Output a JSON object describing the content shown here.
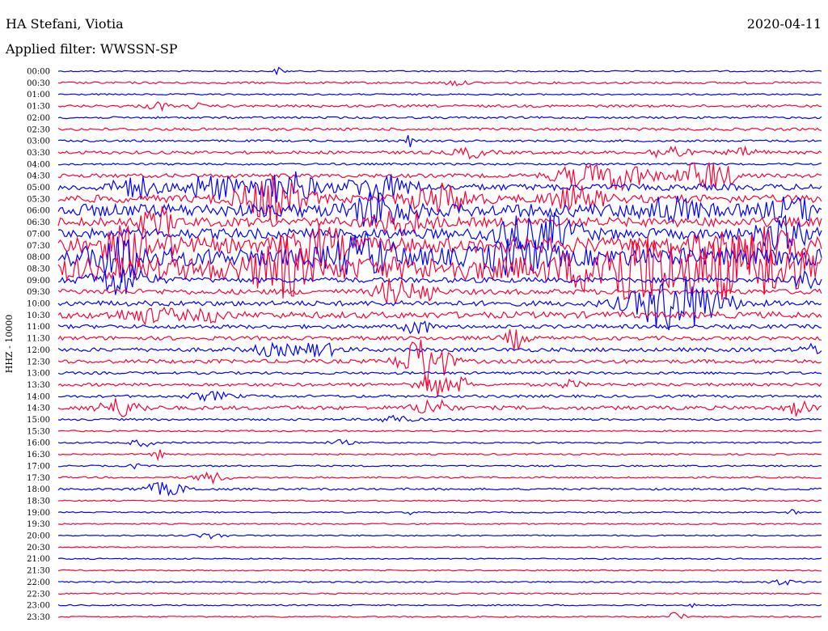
{
  "header": {
    "station": "HA Stefani, Viotia",
    "date": "2020-04-11",
    "filter_label": "Applied filter: WWSSN-SP"
  },
  "chart_data": {
    "type": "line",
    "title": "HA Stefani, Viotia",
    "ylabel": "HHZ - 10000",
    "x_unit": "minutes",
    "xlim": [
      0,
      30
    ],
    "colors": {
      "blue": "#0000ff",
      "red": "#ff0033"
    },
    "series": [
      {
        "label": "00:00",
        "color": "blue",
        "level": 0.05,
        "events": [
          {
            "at": 0.29,
            "amp": 0.3,
            "dur": 0.01
          }
        ]
      },
      {
        "label": "00:30",
        "color": "red",
        "level": 0.08,
        "events": [
          {
            "at": 0.52,
            "amp": 0.2,
            "dur": 0.02
          }
        ]
      },
      {
        "label": "01:00",
        "color": "blue",
        "level": 0.06,
        "events": []
      },
      {
        "label": "01:30",
        "color": "red",
        "level": 0.1,
        "events": [
          {
            "at": 0.13,
            "amp": 0.3,
            "dur": 0.02
          },
          {
            "at": 0.18,
            "amp": 0.25,
            "dur": 0.01
          }
        ]
      },
      {
        "label": "02:00",
        "color": "blue",
        "level": 0.08,
        "events": []
      },
      {
        "label": "02:30",
        "color": "red",
        "level": 0.1,
        "events": []
      },
      {
        "label": "03:00",
        "color": "blue",
        "level": 0.08,
        "events": [
          {
            "at": 0.46,
            "amp": 0.5,
            "dur": 0.005
          }
        ]
      },
      {
        "label": "03:30",
        "color": "red",
        "level": 0.12,
        "events": [
          {
            "at": 0.54,
            "amp": 0.4,
            "dur": 0.03
          },
          {
            "at": 0.8,
            "amp": 0.6,
            "dur": 0.03
          },
          {
            "at": 0.9,
            "amp": 0.3,
            "dur": 0.03
          }
        ]
      },
      {
        "label": "04:00",
        "color": "blue",
        "level": 0.08,
        "events": []
      },
      {
        "label": "04:30",
        "color": "red",
        "level": 0.15,
        "events": [
          {
            "at": 0.68,
            "amp": 0.7,
            "dur": 0.05
          },
          {
            "at": 0.74,
            "amp": 1.0,
            "dur": 0.05
          },
          {
            "at": 0.85,
            "amp": 1.2,
            "dur": 0.05
          }
        ]
      },
      {
        "label": "05:00",
        "color": "blue",
        "level": 0.25,
        "events": [
          {
            "at": 0.1,
            "amp": 0.8,
            "dur": 0.04
          },
          {
            "at": 0.2,
            "amp": 0.9,
            "dur": 0.05
          },
          {
            "at": 0.3,
            "amp": 1.2,
            "dur": 0.05
          },
          {
            "at": 0.42,
            "amp": 0.9,
            "dur": 0.06
          }
        ]
      },
      {
        "label": "05:30",
        "color": "red",
        "level": 0.3,
        "events": [
          {
            "at": 0.28,
            "amp": 1.6,
            "dur": 0.06
          },
          {
            "at": 0.5,
            "amp": 1.0,
            "dur": 0.06
          },
          {
            "at": 0.68,
            "amp": 0.8,
            "dur": 0.05
          }
        ]
      },
      {
        "label": "06:00",
        "color": "blue",
        "level": 0.5,
        "events": [
          {
            "at": 0.42,
            "amp": 1.2,
            "dur": 0.05
          },
          {
            "at": 0.8,
            "amp": 0.8,
            "dur": 0.05
          },
          {
            "at": 0.96,
            "amp": 0.8,
            "dur": 0.04
          }
        ]
      },
      {
        "label": "06:30",
        "color": "red",
        "level": 0.35,
        "events": [
          {
            "at": 0.13,
            "amp": 1.0,
            "dur": 0.03
          },
          {
            "at": 0.45,
            "amp": 0.8,
            "dur": 0.05
          }
        ]
      },
      {
        "label": "07:00",
        "color": "blue",
        "level": 0.4,
        "events": [
          {
            "at": 0.59,
            "amp": 1.0,
            "dur": 0.04
          },
          {
            "at": 0.65,
            "amp": 1.2,
            "dur": 0.05
          },
          {
            "at": 0.95,
            "amp": 1.0,
            "dur": 0.05
          }
        ]
      },
      {
        "label": "07:30",
        "color": "red",
        "level": 0.6,
        "events": [
          {
            "at": 0.1,
            "amp": 1.2,
            "dur": 0.06
          },
          {
            "at": 0.34,
            "amp": 1.2,
            "dur": 0.05
          },
          {
            "at": 0.9,
            "amp": 1.6,
            "dur": 0.08
          }
        ]
      },
      {
        "label": "08:00",
        "color": "blue",
        "level": 0.7,
        "events": [
          {
            "at": 0.08,
            "amp": 1.6,
            "dur": 0.04
          },
          {
            "at": 0.4,
            "amp": 1.2,
            "dur": 0.06
          },
          {
            "at": 0.6,
            "amp": 1.0,
            "dur": 0.06
          }
        ]
      },
      {
        "label": "08:30",
        "color": "red",
        "level": 0.9,
        "events": [
          {
            "at": 0.29,
            "amp": 2.0,
            "dur": 0.04
          },
          {
            "at": 0.75,
            "amp": 2.2,
            "dur": 0.1
          },
          {
            "at": 0.9,
            "amp": 1.8,
            "dur": 0.1
          }
        ]
      },
      {
        "label": "09:00",
        "color": "blue",
        "level": 0.2,
        "events": [
          {
            "at": 0.08,
            "amp": 1.2,
            "dur": 0.05
          },
          {
            "at": 0.98,
            "amp": 0.8,
            "dur": 0.02
          }
        ]
      },
      {
        "label": "09:30",
        "color": "red",
        "level": 0.2,
        "events": [
          {
            "at": 0.44,
            "amp": 1.0,
            "dur": 0.03
          },
          {
            "at": 0.48,
            "amp": 0.8,
            "dur": 0.02
          }
        ]
      },
      {
        "label": "10:00",
        "color": "blue",
        "level": 0.2,
        "events": [
          {
            "at": 0.81,
            "amp": 2.2,
            "dur": 0.08
          }
        ]
      },
      {
        "label": "10:30",
        "color": "red",
        "level": 0.25,
        "events": [
          {
            "at": 0.12,
            "amp": 0.5,
            "dur": 0.06
          },
          {
            "at": 0.2,
            "amp": 0.4,
            "dur": 0.03
          }
        ]
      },
      {
        "label": "11:00",
        "color": "blue",
        "level": 0.15,
        "events": [
          {
            "at": 0.47,
            "amp": 0.8,
            "dur": 0.02
          }
        ]
      },
      {
        "label": "11:30",
        "color": "red",
        "level": 0.15,
        "events": [
          {
            "at": 0.6,
            "amp": 0.8,
            "dur": 0.02
          }
        ]
      },
      {
        "label": "12:00",
        "color": "blue",
        "level": 0.15,
        "events": [
          {
            "at": 0.28,
            "amp": 0.4,
            "dur": 0.04
          },
          {
            "at": 0.34,
            "amp": 0.5,
            "dur": 0.04
          },
          {
            "at": 0.99,
            "amp": 0.4,
            "dur": 0.02
          }
        ]
      },
      {
        "label": "12:30",
        "color": "red",
        "level": 0.15,
        "events": [
          {
            "at": 0.48,
            "amp": 2.2,
            "dur": 0.04
          }
        ]
      },
      {
        "label": "13:00",
        "color": "blue",
        "level": 0.1,
        "events": []
      },
      {
        "label": "13:30",
        "color": "red",
        "level": 0.12,
        "events": [
          {
            "at": 0.49,
            "amp": 1.0,
            "dur": 0.03
          },
          {
            "at": 0.53,
            "amp": 0.7,
            "dur": 0.01
          },
          {
            "at": 0.67,
            "amp": 0.3,
            "dur": 0.02
          }
        ]
      },
      {
        "label": "14:00",
        "color": "blue",
        "level": 0.1,
        "events": [
          {
            "at": 0.2,
            "amp": 0.3,
            "dur": 0.04
          }
        ]
      },
      {
        "label": "14:30",
        "color": "red",
        "level": 0.15,
        "events": [
          {
            "at": 0.08,
            "amp": 0.7,
            "dur": 0.04
          },
          {
            "at": 0.49,
            "amp": 0.7,
            "dur": 0.03
          },
          {
            "at": 0.97,
            "amp": 0.6,
            "dur": 0.02
          }
        ]
      },
      {
        "label": "15:00",
        "color": "blue",
        "level": 0.08,
        "events": [
          {
            "at": 0.44,
            "amp": 0.3,
            "dur": 0.03
          }
        ]
      },
      {
        "label": "15:30",
        "color": "red",
        "level": 0.06,
        "events": []
      },
      {
        "label": "16:00",
        "color": "blue",
        "level": 0.06,
        "events": [
          {
            "at": 0.11,
            "amp": 0.3,
            "dur": 0.02
          },
          {
            "at": 0.37,
            "amp": 0.2,
            "dur": 0.02
          }
        ]
      },
      {
        "label": "16:30",
        "color": "red",
        "level": 0.06,
        "events": [
          {
            "at": 0.13,
            "amp": 0.4,
            "dur": 0.01
          }
        ]
      },
      {
        "label": "17:00",
        "color": "blue",
        "level": 0.06,
        "events": [
          {
            "at": 0.1,
            "amp": 0.2,
            "dur": 0.01
          }
        ]
      },
      {
        "label": "17:30",
        "color": "red",
        "level": 0.06,
        "events": [
          {
            "at": 0.2,
            "amp": 0.4,
            "dur": 0.03
          }
        ]
      },
      {
        "label": "18:00",
        "color": "blue",
        "level": 0.08,
        "events": [
          {
            "at": 0.14,
            "amp": 0.5,
            "dur": 0.04
          }
        ]
      },
      {
        "label": "18:30",
        "color": "red",
        "level": 0.05,
        "events": []
      },
      {
        "label": "19:00",
        "color": "blue",
        "level": 0.05,
        "events": [
          {
            "at": 0.46,
            "amp": 0.2,
            "dur": 0.005
          },
          {
            "at": 0.96,
            "amp": 0.3,
            "dur": 0.01
          }
        ]
      },
      {
        "label": "19:30",
        "color": "red",
        "level": 0.05,
        "events": []
      },
      {
        "label": "20:00",
        "color": "blue",
        "level": 0.05,
        "events": [
          {
            "at": 0.2,
            "amp": 0.2,
            "dur": 0.03
          }
        ]
      },
      {
        "label": "20:30",
        "color": "red",
        "level": 0.04,
        "events": []
      },
      {
        "label": "21:00",
        "color": "blue",
        "level": 0.05,
        "events": []
      },
      {
        "label": "21:30",
        "color": "red",
        "level": 0.05,
        "events": []
      },
      {
        "label": "22:00",
        "color": "blue",
        "level": 0.05,
        "events": [
          {
            "at": 0.95,
            "amp": 0.2,
            "dur": 0.03
          }
        ]
      },
      {
        "label": "22:30",
        "color": "red",
        "level": 0.05,
        "events": []
      },
      {
        "label": "23:00",
        "color": "blue",
        "level": 0.05,
        "events": [
          {
            "at": 0.83,
            "amp": 0.3,
            "dur": 0.005
          }
        ]
      },
      {
        "label": "23:30",
        "color": "red",
        "level": 0.05,
        "events": [
          {
            "at": 0.81,
            "amp": 0.5,
            "dur": 0.015
          }
        ]
      }
    ]
  }
}
